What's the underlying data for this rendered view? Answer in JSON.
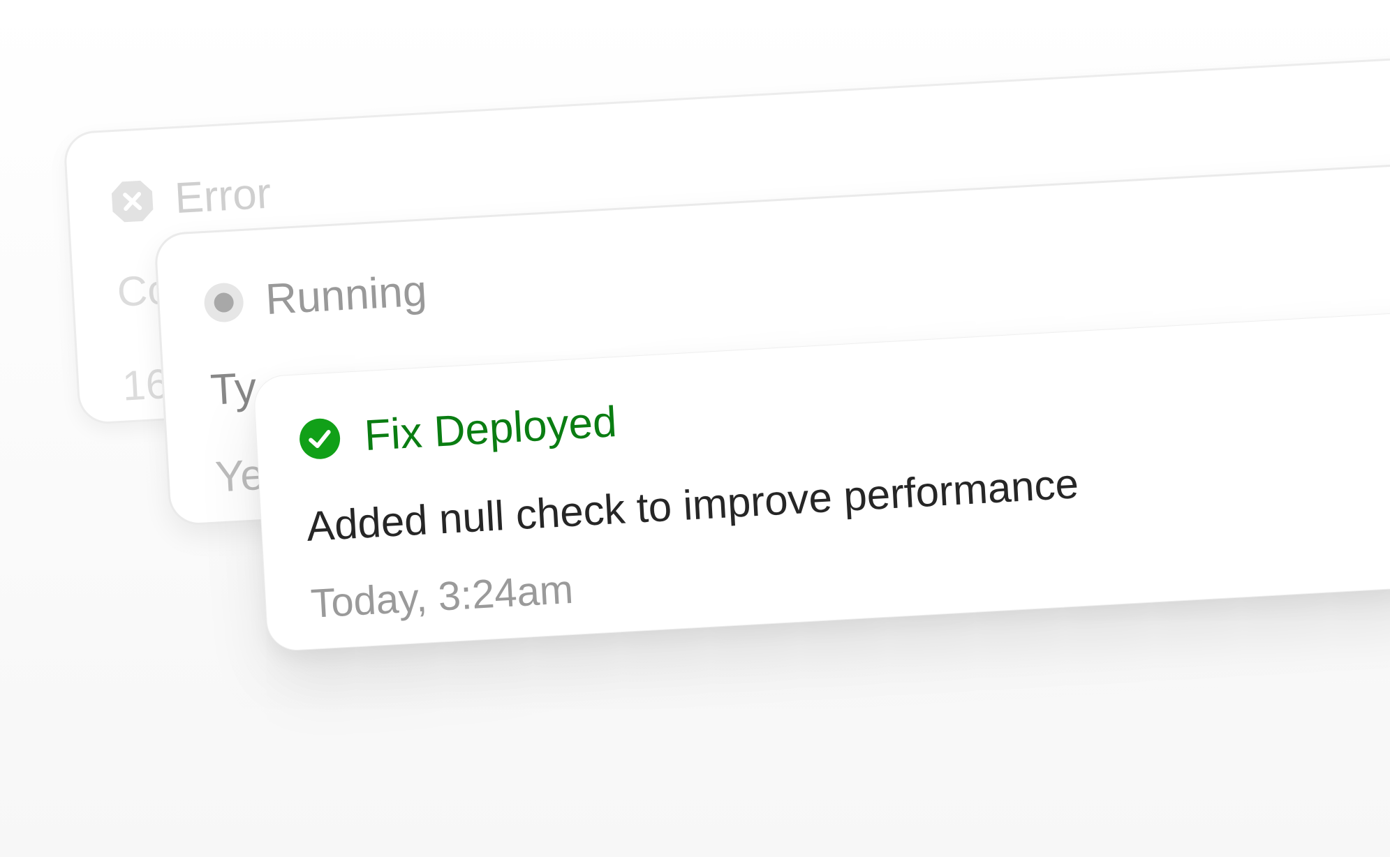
{
  "colors": {
    "success_green": "#0a7d12",
    "success_icon": "#11a018",
    "running_gray": "#999999",
    "error_gray": "#d4d4d4",
    "text_dark": "#262626",
    "text_muted": "#9a9a9a"
  },
  "cards": {
    "error": {
      "status": "Error",
      "icon": "x-circle-icon",
      "line1": "Co",
      "line2": "16"
    },
    "running": {
      "status": "Running",
      "icon": "radio-dot-icon",
      "line1": "Ty",
      "line2": "Ye"
    },
    "deployed": {
      "status": "Fix Deployed",
      "icon": "check-circle-icon",
      "description": "Added null check to improve performance",
      "timestamp": "Today, 3:24am"
    }
  }
}
